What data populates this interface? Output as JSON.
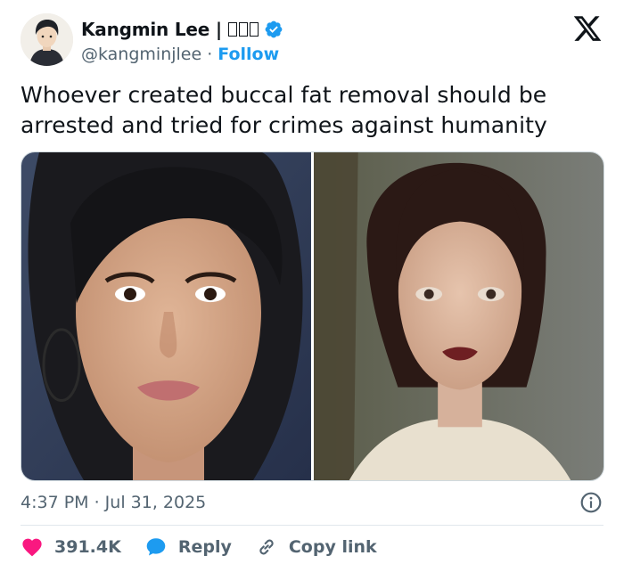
{
  "author": {
    "name": "Kangmin Lee | ",
    "name_glyph_count": 3,
    "handle": "@kangminjlee",
    "separator": "·",
    "follow_label": "Follow"
  },
  "tweet": {
    "text": "Whoever created buccal fat removal should be arrested and tried for crimes against humanity"
  },
  "media": {
    "left_photo": "woman-portrait-before",
    "right_photo": "woman-portrait-after"
  },
  "meta": {
    "timestamp": "4:37 PM · Jul 31, 2025"
  },
  "actions": {
    "likes": "391.4K",
    "reply_label": "Reply",
    "copy_label": "Copy link"
  },
  "colors": {
    "accent": "#1d9bf0",
    "like": "#f91880",
    "text": "#0f1419",
    "muted": "#536471"
  },
  "icons": {
    "logo": "x-logo-icon",
    "verified": "verified-badge-icon",
    "info": "info-icon",
    "like": "heart-icon",
    "reply": "speech-bubble-icon",
    "copy": "link-icon"
  }
}
